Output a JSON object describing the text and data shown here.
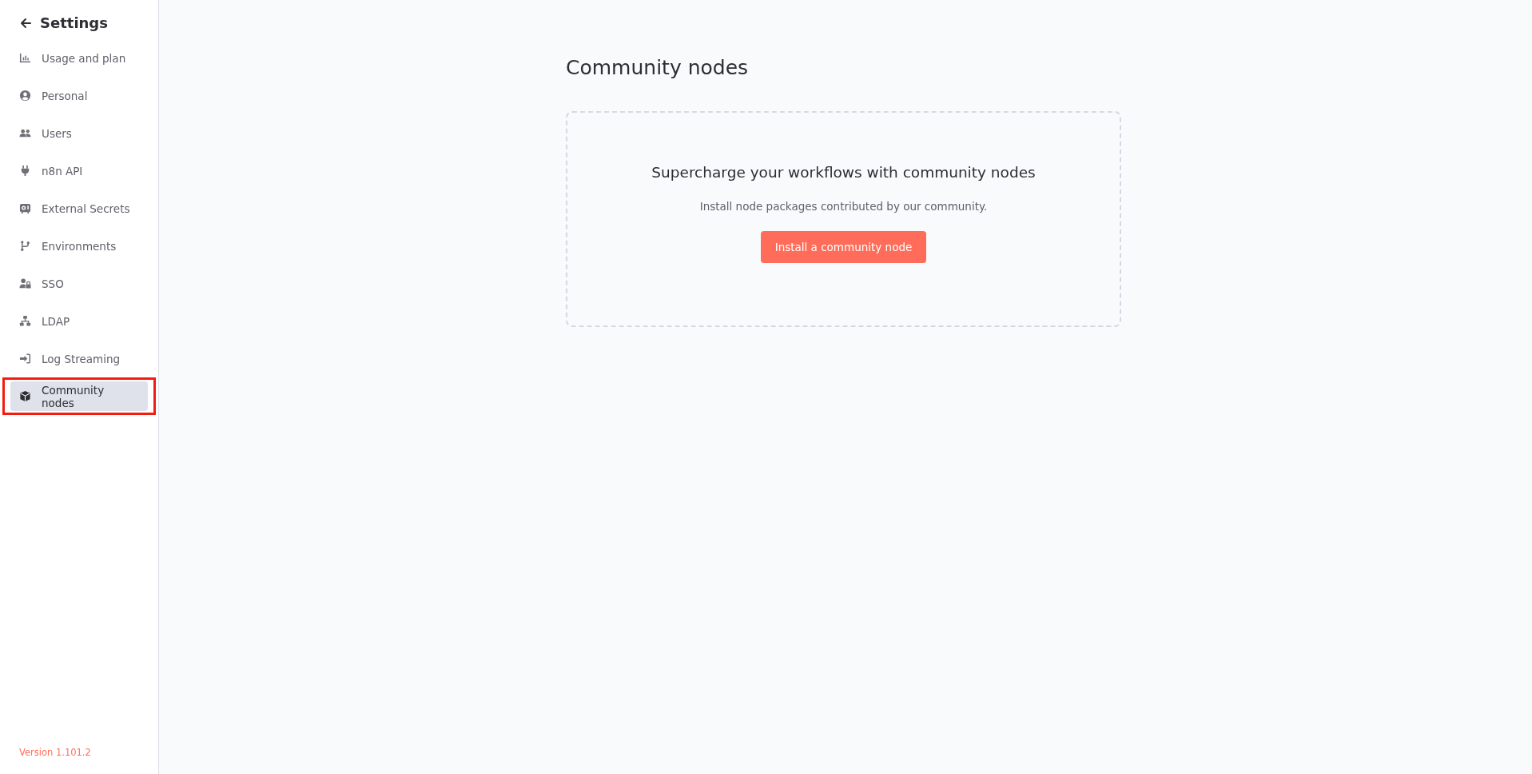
{
  "sidebar": {
    "title": "Settings",
    "items": [
      {
        "label": "Usage and plan",
        "selected": false
      },
      {
        "label": "Personal",
        "selected": false
      },
      {
        "label": "Users",
        "selected": false
      },
      {
        "label": "n8n API",
        "selected": false
      },
      {
        "label": "External Secrets",
        "selected": false
      },
      {
        "label": "Environments",
        "selected": false
      },
      {
        "label": "SSO",
        "selected": false
      },
      {
        "label": "LDAP",
        "selected": false
      },
      {
        "label": "Log Streaming",
        "selected": false
      },
      {
        "label": "Community nodes",
        "selected": true
      }
    ],
    "version": "Version 1.101.2"
  },
  "main": {
    "heading": "Community nodes",
    "empty_state": {
      "title": "Supercharge your workflows with community nodes",
      "description": "Install node packages contributed by our community.",
      "button": "Install a community node"
    }
  }
}
